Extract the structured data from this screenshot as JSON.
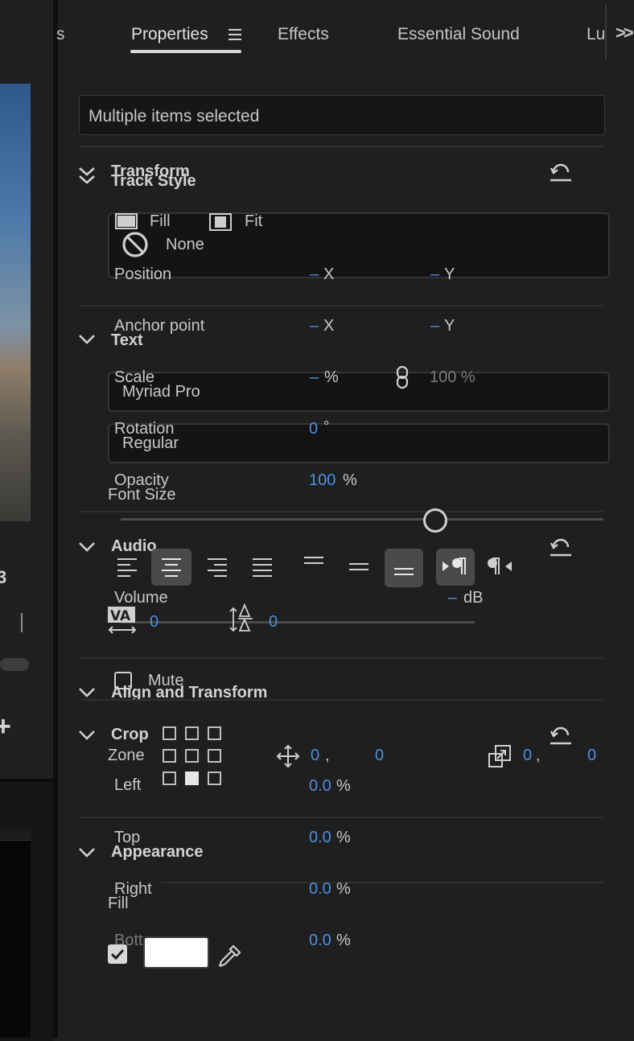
{
  "tabs": {
    "left_partial": "s",
    "properties": "Properties",
    "effects": "Effects",
    "essential_sound": "Essential Sound",
    "partial": "Lu",
    "overflow": ">>"
  },
  "selection": "Multiple items selected",
  "transform": {
    "title": "Transform",
    "position": "Position",
    "anchor_point": "Anchor point",
    "scale": "Scale",
    "rotation": "Rotation",
    "opacity": "Opacity",
    "x_dash": "–",
    "x": "X",
    "y_dash": "–",
    "y": "Y",
    "scale_dash": "–",
    "percent": "%",
    "scale_linked": "100 %",
    "rotation_value": "0",
    "degree": "°",
    "opacity_value": "100"
  },
  "track_style": {
    "title": "Track Style",
    "fill": "Fill",
    "fit": "Fit",
    "none": "None"
  },
  "text": {
    "title": "Text",
    "font": "Myriad Pro",
    "style": "Regular",
    "font_size_label": "Font Size",
    "tracking_value": "0",
    "leading_value": "0",
    "slider_level": 0.6
  },
  "audio": {
    "title": "Audio",
    "volume": "Volume",
    "volume_dash": "–",
    "db": "dB",
    "mute": "Mute"
  },
  "align_transform": {
    "title": "Align and Transform",
    "zone": "Zone",
    "pos_x": "0",
    "pos_comma": ",",
    "pos_y": "0",
    "size_x": "0",
    "size_comma": ",",
    "size_y": "0"
  },
  "crop": {
    "title": "Crop",
    "left": "Left",
    "top": "Top",
    "right": "Right",
    "bottom": "Bottom",
    "left_value": "0.0",
    "top_value": "0.0",
    "right_value": "0.0",
    "bottom_value": "0.0",
    "percent": "%"
  },
  "appearance": {
    "title": "Appearance",
    "fill": "Fill",
    "fill_color": "#ffffff",
    "fill_checked": true
  },
  "left_panel": {
    "partial_digit": "3",
    "plus": "+"
  },
  "colors": {
    "accent_blue": "#4a90e2",
    "panel_bg": "#1f1f1f",
    "text": "#c8c8c8"
  }
}
